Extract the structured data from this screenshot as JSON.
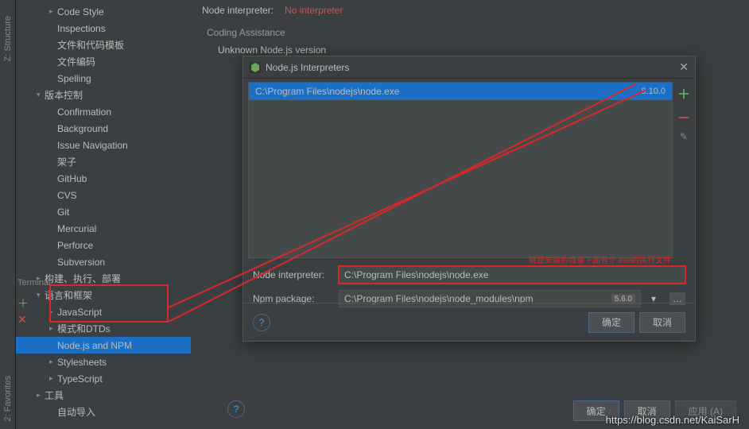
{
  "rail": {
    "structure": "Z: Structure",
    "favorites": "2: Favorites"
  },
  "tree": {
    "codeStyle": "Code Style",
    "inspections": "Inspections",
    "fileTpl": "文件和代码模板",
    "fileEnc": "文件编码",
    "spelling": "Spelling",
    "vcs": "版本控制",
    "confirmation": "Confirmation",
    "background": "Background",
    "issueNav": "Issue Navigation",
    "shelf": "架子",
    "github": "GitHub",
    "cvs": "CVS",
    "git": "Git",
    "mercurial": "Mercurial",
    "perforce": "Perforce",
    "subversion": "Subversion",
    "build": "构建、执行、部署",
    "lang": "语言和框架",
    "javascript": "JavaScript",
    "schemas": "模式和DTDs",
    "nodenpm": "Node.js and NPM",
    "stylesheets": "Stylesheets",
    "typescript": "TypeScript",
    "tools": "工具",
    "autoimport": "自动导入"
  },
  "main": {
    "nodeInterpLabel": "Node interpreter:",
    "noInterp": "No interpreter",
    "coding": "Coding Assistance",
    "unknown": "Unknown Node.js version"
  },
  "dialog": {
    "title": "Node.js Interpreters",
    "listPath": "C:\\Program Files\\nodejs\\node.exe",
    "listVer": "8.10.0",
    "nodeLabel": "Node interpreter:",
    "nodeVal": "C:\\Program Files\\nodejs\\node.exe",
    "npmLabel": "Npm package:",
    "npmVal": "C:\\Program Files\\nodejs\\node_modules\\npm",
    "npmVer": "5.6.0",
    "ok": "确定",
    "cancel": "取消",
    "annotation": "就是安装的目录下面有个.exe的执行文件"
  },
  "footer": {
    "ok": "确定",
    "cancel": "取消",
    "apply": "应用 (A)"
  },
  "terminal": "Terminal",
  "watermark": "https://blog.csdn.net/KaiSarH"
}
